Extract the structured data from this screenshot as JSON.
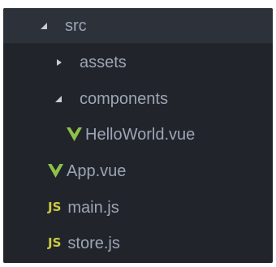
{
  "colors": {
    "background": "#21252b",
    "selected_row": "#2c313a",
    "text": "#9da5b4",
    "vue_green": "#8dc149",
    "js_yellow": "#cbcb41"
  },
  "tree": {
    "src": {
      "label": "src",
      "icon": "caret-down-icon",
      "expanded": true
    },
    "assets": {
      "label": "assets",
      "icon": "caret-right-icon",
      "expanded": false
    },
    "components": {
      "label": "components",
      "icon": "caret-down-icon",
      "expanded": true
    },
    "hello_world": {
      "label": "HelloWorld.vue",
      "icon": "vue-icon"
    },
    "app": {
      "label": "App.vue",
      "icon": "vue-icon"
    },
    "main": {
      "label": "main.js",
      "icon": "js-icon",
      "icon_text": "JS"
    },
    "store": {
      "label": "store.js",
      "icon": "js-icon",
      "icon_text": "JS"
    }
  }
}
